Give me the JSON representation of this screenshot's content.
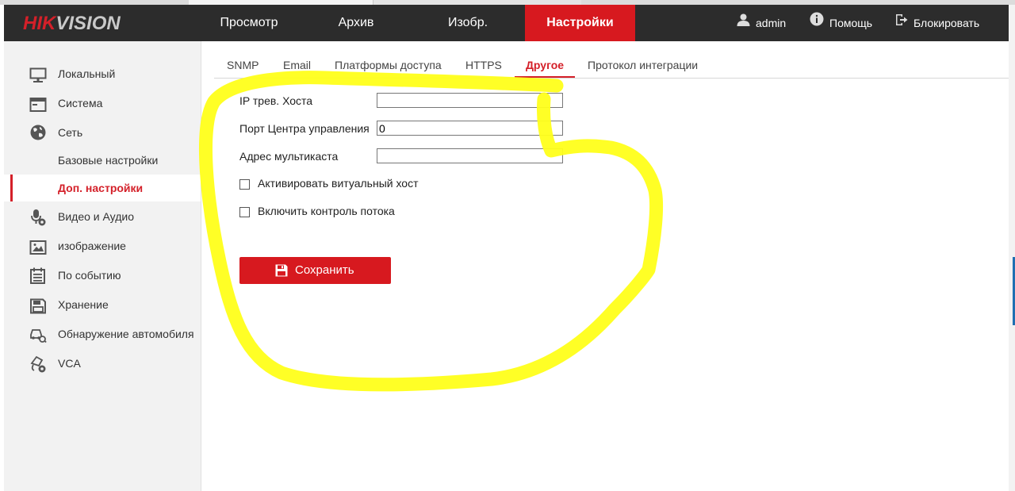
{
  "brand": {
    "logo_left": "HIK",
    "logo_right": "VISION"
  },
  "topnav": [
    {
      "label": "Просмотр",
      "active": false
    },
    {
      "label": "Архив",
      "active": false
    },
    {
      "label": "Изобр.",
      "active": false
    },
    {
      "label": "Настройки",
      "active": true
    }
  ],
  "header": {
    "user": "admin",
    "help": "Помощь",
    "lock": "Блокировать"
  },
  "sidebar": {
    "items": [
      {
        "label": "Локальный",
        "icon": "monitor-icon"
      },
      {
        "label": "Система",
        "icon": "system-icon"
      },
      {
        "label": "Сеть",
        "icon": "globe-icon"
      },
      {
        "label": "Базовые настройки",
        "icon": ""
      },
      {
        "label": "Доп. настройки",
        "icon": "",
        "active": true
      },
      {
        "label": "Видео и Аудио",
        "icon": "microphone-icon"
      },
      {
        "label": "изображение",
        "icon": "image-icon"
      },
      {
        "label": "По событию",
        "icon": "calendar-icon"
      },
      {
        "label": "Хранение",
        "icon": "storage-icon"
      },
      {
        "label": "Обнаружение автомобиля",
        "icon": "car-detection-icon"
      },
      {
        "label": "VCA",
        "icon": "vca-icon"
      }
    ]
  },
  "tabs": [
    {
      "label": "SNMP",
      "active": false
    },
    {
      "label": "Email",
      "active": false
    },
    {
      "label": "Платформы доступа",
      "active": false
    },
    {
      "label": "HTTPS",
      "active": false
    },
    {
      "label": "Другое",
      "active": true
    },
    {
      "label": "Протокол интеграции",
      "active": false
    }
  ],
  "form": {
    "alarm_host_ip_label": "IP трев. Хоста",
    "alarm_host_ip_value": "",
    "control_center_port_label": "Порт Центра управления",
    "control_center_port_value": "0",
    "multicast_address_label": "Адрес мультикаста",
    "multicast_address_value": "",
    "virtual_host_label": "Активировать витуальный хост",
    "virtual_host_checked": false,
    "flow_control_label": "Включить контроль потока",
    "flow_control_checked": false,
    "save_label": "Сохранить"
  },
  "colors": {
    "accent": "#d7191f",
    "header_bg": "#2c2c2c",
    "sidebar_bg": "#f2f2f2",
    "highlight": "#ffff00"
  }
}
